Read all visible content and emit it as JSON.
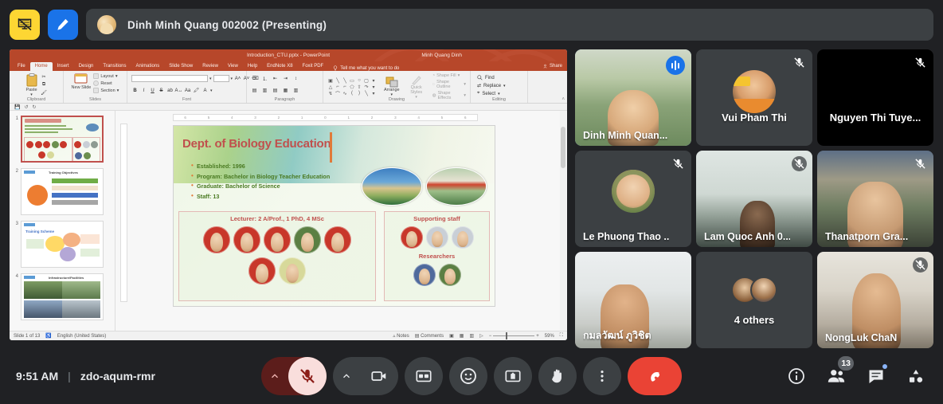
{
  "meeting": {
    "time": "9:51 AM",
    "code": "zdo-aqum-rmr",
    "separator": "|"
  },
  "topbar": {
    "stop_presenting_icon": "presentation-off-icon",
    "annotate_icon": "pen-annotate-icon",
    "presenter_label": "Dinh Minh Quang 002002 (Presenting)"
  },
  "shared_screen": {
    "app": "PowerPoint",
    "title_bar": "Introduction_CTU.pptx - PowerPoint",
    "account": "Minh Quang Dinh",
    "share_label": "Share",
    "tell_me_placeholder": "Tell me what you want to do",
    "tabs": [
      {
        "label": "File",
        "active": false
      },
      {
        "label": "Home",
        "active": true
      },
      {
        "label": "Insert",
        "active": false
      },
      {
        "label": "Design",
        "active": false
      },
      {
        "label": "Transitions",
        "active": false
      },
      {
        "label": "Animations",
        "active": false
      },
      {
        "label": "Slide Show",
        "active": false
      },
      {
        "label": "Review",
        "active": false
      },
      {
        "label": "View",
        "active": false
      },
      {
        "label": "Help",
        "active": false
      },
      {
        "label": "EndNote X8",
        "active": false
      },
      {
        "label": "Foxit PDF",
        "active": false
      }
    ],
    "ribbon_groups": [
      {
        "name": "Clipboard",
        "items": [
          "Paste"
        ]
      },
      {
        "name": "Slides",
        "items": [
          "New Slide",
          "Layout",
          "Reset",
          "Section"
        ]
      },
      {
        "name": "Font",
        "items": [
          "B",
          "I",
          "U",
          "S"
        ]
      },
      {
        "name": "Paragraph",
        "items": []
      },
      {
        "name": "Drawing",
        "items": [
          "Arrange",
          "Quick Styles",
          "Shape Fill",
          "Shape Outline",
          "Shape Effects"
        ]
      },
      {
        "name": "Editing",
        "items": [
          "Find",
          "Replace",
          "Select"
        ]
      }
    ],
    "ruler_ticks": [
      "6",
      "5",
      "4",
      "3",
      "2",
      "1",
      "0",
      "1",
      "2",
      "3",
      "4",
      "5",
      "6"
    ],
    "thumbnails": [
      {
        "number": "1",
        "selected": true,
        "title": "Dept. of Biology Education"
      },
      {
        "number": "2",
        "selected": false,
        "title": "Training Objectives"
      },
      {
        "number": "3",
        "selected": false,
        "title": "Training Scheme"
      },
      {
        "number": "4",
        "selected": false,
        "title": "Infrastructure/Facilities"
      }
    ],
    "slide": {
      "title": "Dept. of Biology Education",
      "bullets": [
        "Established: 1996",
        "Program: Bachelor in Biology Teacher Education",
        "Graduate: Bachelor of Science",
        "Staff: 13"
      ],
      "left_panel_heading": "Lecturer: 2 A/Prof., 1 PhD, 4 MSc",
      "right_panel_heading": "Supporting staff",
      "right_panel_subheading": "Researchers"
    },
    "status_bar": {
      "slide_counter": "Slide 1 of 13",
      "language": "English (United States)",
      "notes_label": "Notes",
      "comments_label": "Comments",
      "zoom_level": "59%"
    }
  },
  "participants": [
    {
      "name": "Dinh Minh Quan...",
      "muted": false,
      "speaking": true,
      "video": true,
      "layout": "name-left",
      "style": "vid-quang"
    },
    {
      "name": "Vui Pham Thi",
      "muted": true,
      "speaking": false,
      "video": false,
      "layout": "name-center",
      "style": "avatar-vui"
    },
    {
      "name": "Nguyen Thi Tuye...",
      "muted": true,
      "speaking": false,
      "video": false,
      "layout": "name-center",
      "style": "vid-black"
    },
    {
      "name": "Le Phuong Thao ...",
      "muted": true,
      "speaking": false,
      "video": false,
      "layout": "name-left",
      "style": "avatar-thao"
    },
    {
      "name": "Lam Quoc Anh 0...",
      "muted": true,
      "speaking": false,
      "video": true,
      "layout": "name-left",
      "style": "vid-room"
    },
    {
      "name": "Thanatporn Gra...",
      "muted": true,
      "speaking": false,
      "video": true,
      "layout": "name-left",
      "style": "vid-temple"
    },
    {
      "name": "กมลวัฒน์ ภูวิชิต",
      "muted": false,
      "speaking": false,
      "video": true,
      "layout": "name-left",
      "style": "vid-thai"
    },
    {
      "name": "4 others",
      "muted": false,
      "speaking": false,
      "video": false,
      "layout": "name-center",
      "style": "others"
    },
    {
      "name": "NongLuk ChaN",
      "muted": true,
      "speaking": false,
      "video": true,
      "layout": "name-left",
      "style": "vid-nongluk"
    }
  ],
  "controls": {
    "mic": {
      "label": "mic-off-icon",
      "state": "muted"
    },
    "mic_more": "chevron-up-icon",
    "camera": {
      "label": "camera-off-icon",
      "state": "off"
    },
    "camera_more": "chevron-up-icon",
    "captions": "closed-captions-icon",
    "reactions": "emoji-reactions-icon",
    "present": "present-screen-icon",
    "raise_hand": "raise-hand-icon",
    "more": "more-options-icon",
    "end_call": "end-call-icon"
  },
  "right_controls": {
    "info": "info-icon",
    "people": {
      "icon": "people-icon",
      "count": "13"
    },
    "chat": {
      "icon": "chat-icon",
      "unread": true
    },
    "activities": "activities-icon"
  },
  "colors": {
    "app_bg": "#202124",
    "tile_bg": "#3c4043",
    "accent_blue": "#8ab4f8",
    "brand_blue": "#1a73e8",
    "danger_red": "#ea4335",
    "mic_muted_bg": "#f9dedc",
    "yellow": "#fdd633",
    "ppt_orange": "#b7472a",
    "slide_title": "#c0504d"
  }
}
